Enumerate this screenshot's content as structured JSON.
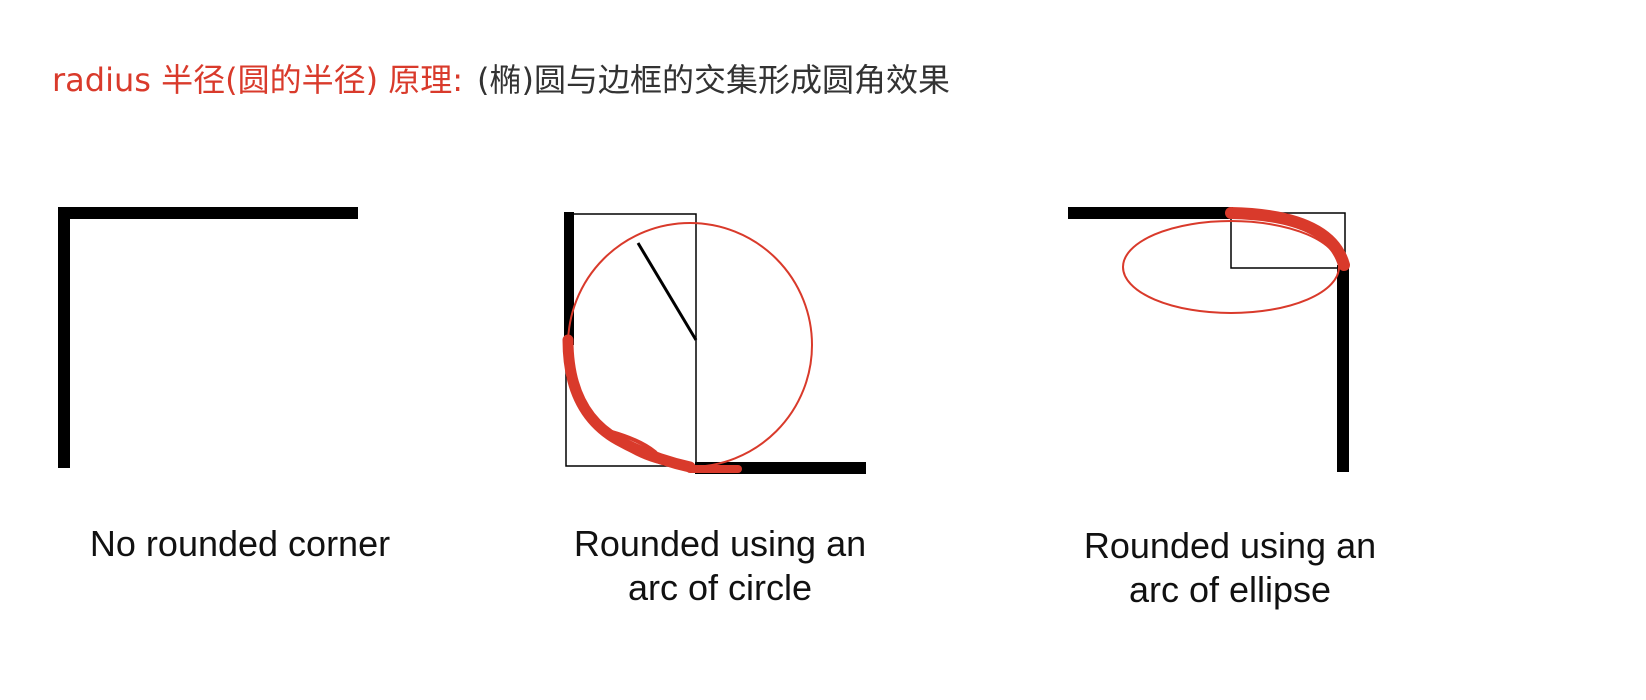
{
  "heading": {
    "accent": "radius 半径(圆的半径) 原理:",
    "rest": "(椭)圆与边框的交集形成圆角效果",
    "accent_color": "#d93a2b"
  },
  "panels": [
    {
      "caption": "No rounded corner"
    },
    {
      "caption_line1": "Rounded using an",
      "caption_line2": "arc of circle"
    },
    {
      "caption_line1": "Rounded using an",
      "caption_line2": "arc of ellipse"
    }
  ]
}
